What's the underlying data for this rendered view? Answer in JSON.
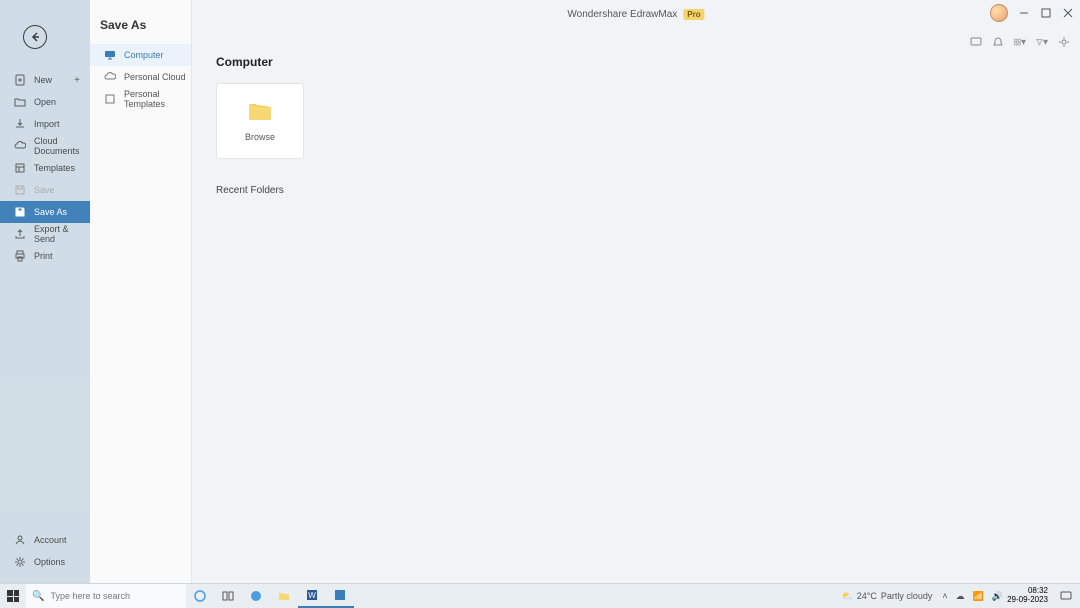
{
  "app": {
    "title": "Wondershare EdrawMax",
    "badge": "Pro"
  },
  "sidebar": {
    "items": [
      {
        "label": "New",
        "has_plus": true
      },
      {
        "label": "Open"
      },
      {
        "label": "Import"
      },
      {
        "label": "Cloud Documents"
      },
      {
        "label": "Templates"
      },
      {
        "label": "Save"
      },
      {
        "label": "Save As"
      },
      {
        "label": "Export & Send"
      },
      {
        "label": "Print"
      }
    ],
    "bottom": [
      {
        "label": "Account"
      },
      {
        "label": "Options"
      }
    ]
  },
  "midpanel": {
    "title": "Save As",
    "items": [
      {
        "label": "Computer"
      },
      {
        "label": "Personal Cloud"
      },
      {
        "label": "Personal Templates"
      }
    ]
  },
  "main": {
    "heading": "Computer",
    "browse_label": "Browse",
    "recent_heading": "Recent Folders"
  },
  "taskbar": {
    "search_placeholder": "Type here to search",
    "weather_temp": "24°C",
    "weather_desc": "Partly cloudy",
    "time": "08:32",
    "date": "29-09-2023"
  }
}
